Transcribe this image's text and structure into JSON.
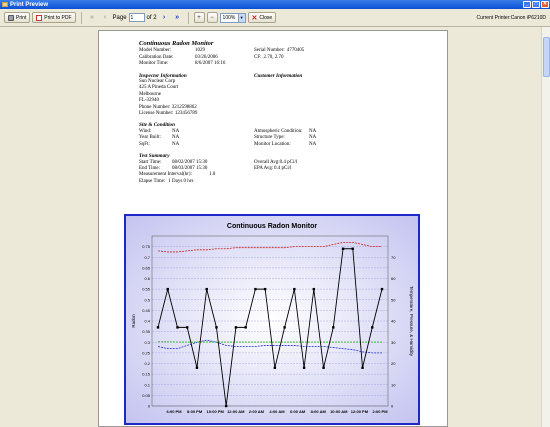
{
  "window": {
    "title": "Print Preview"
  },
  "toolbar": {
    "print_label": "Print",
    "pdf_label": "Print to PDF",
    "page_label": "Page",
    "page_value": "1",
    "page_of": "of 2",
    "zoom_value": "100%",
    "close_label": "Close",
    "printer_label": "Current Printer:Canon iP6210D"
  },
  "report": {
    "title": "Continuous Radon Monitor",
    "model_label": "Model Number:",
    "model_value": "1029",
    "serial_label": "Serial Number:",
    "serial_value": "4770405",
    "calibration_label": "Calibration Date:",
    "calibration_value": "03/26/2006",
    "cf_label": "CF:",
    "cf_value": "2.70, 2.70",
    "monitor_time_label": "Monitor Time:",
    "monitor_time_value": "8/6/2007 16:16",
    "inspector_heading": "Inspector Information",
    "customer_heading": "Customer Information",
    "inspector_lines": [
      "Sun Nuclear Corp",
      "425 A Pineda Court",
      "Melbourne",
      "FL-32940",
      "Phone Number: 3212598862",
      "License Number: 123456789"
    ],
    "site_heading": "Site & Condition",
    "wind_label": "Wind:",
    "wind_value": "NA",
    "atmo_label": "Atmospheric Condition:",
    "atmo_value": "NA",
    "year_label": "Year Built:",
    "year_value": "NA",
    "struct_label": "Structure Type:",
    "struct_value": "NA",
    "sqft_label": "SqFt:",
    "sqft_value": "NA",
    "location_label": "Monitor Location:",
    "location_value": "NA",
    "test_heading": "Test Summary",
    "start_label": "Start Time:",
    "start_value": "08/02/2007 15:30",
    "overall_label": "Overall Avg:",
    "overall_value": "0.4 pCi/l",
    "end_label": "End Time:",
    "end_value": "08/03/2007 15:30",
    "epa_label": "EPA Avg:",
    "epa_value": "0.4 pCi/l",
    "interval_label": "Measurement Interval(hr):",
    "interval_value": "1.0",
    "elapse_label": "Elapse Time:",
    "elapse_value": "1 Days  0 hrs"
  },
  "chart_data": {
    "type": "line",
    "title": "Continuous Radon Monitor",
    "ylabel": "Radon",
    "y2label": "Temperature, Pressure, & Humidity",
    "ylim": [
      0,
      0.8
    ],
    "y2lim": [
      0,
      80
    ],
    "yticks": [
      "0",
      "0.05",
      "0.1",
      "0.15",
      "0.2",
      "0.25",
      "0.3",
      "0.35",
      "0.4",
      "0.45",
      "0.5",
      "0.55",
      "0.6",
      "0.65",
      "0.7",
      "0.75"
    ],
    "y2ticks": [
      "0",
      "10",
      "20",
      "30",
      "40",
      "50",
      "60",
      "70"
    ],
    "xticks": [
      "6:00 PM",
      "8:00 PM",
      "10:00 PM",
      "12:00 AM",
      "2:00 AM",
      "4:00 AM",
      "6:00 AM",
      "8:00 AM",
      "10:00 AM",
      "12:00 PM",
      "2:00 PM"
    ],
    "grid": true,
    "series": [
      {
        "values": [
          0.37,
          0.55,
          0.37,
          0.37,
          0.18,
          0.55,
          0.37,
          0.0,
          0.37,
          0.37,
          0.55,
          0.55,
          0.18,
          0.37,
          0.55,
          0.18,
          0.55,
          0.18,
          0.37,
          0.74,
          0.74,
          0.18,
          0.37,
          0.55
        ],
        "color": "#000000"
      },
      {
        "values": [
          73,
          72.5,
          72.5,
          73,
          73.5,
          73.5,
          74,
          74,
          74.5,
          74.5,
          74.5,
          74.5,
          74.5,
          74.5,
          75,
          75,
          75,
          75,
          76,
          77,
          77,
          76,
          75,
          75
        ],
        "color": "#d02020",
        "axis": "right"
      },
      {
        "values": [
          28,
          27,
          27,
          28.5,
          30,
          31,
          30,
          28.5,
          28,
          28,
          28,
          28.5,
          28.5,
          28.5,
          28.5,
          28,
          28,
          28,
          27.5,
          27,
          26.5,
          25.5,
          25,
          25
        ],
        "color": "#2030d0",
        "axis": "right"
      },
      {
        "values": [
          30.2,
          30.2,
          30.1,
          30.1,
          30.1,
          30.1,
          30.1,
          30.1,
          30.1,
          30.1,
          30.1,
          30.1,
          30.1,
          30.1,
          30.1,
          30.1,
          30.1,
          30.1,
          30.1,
          30.1,
          30.1,
          30.1,
          30.1,
          30.1
        ],
        "color": "#20b020",
        "axis": "right"
      }
    ]
  },
  "colors": {
    "titlebar": "#0a4fd6",
    "chart_border": "#1c28c8",
    "chart_bg": "#e8e8ff"
  },
  "icons": {
    "print": "printer-icon",
    "pdf": "pdf-icon",
    "first": "first-page-icon",
    "prev": "prev-page-icon",
    "next": "next-page-icon",
    "last": "last-page-icon",
    "zoom_in": "zoom-in-icon",
    "zoom_out": "zoom-out-icon",
    "close": "close-x-icon"
  }
}
